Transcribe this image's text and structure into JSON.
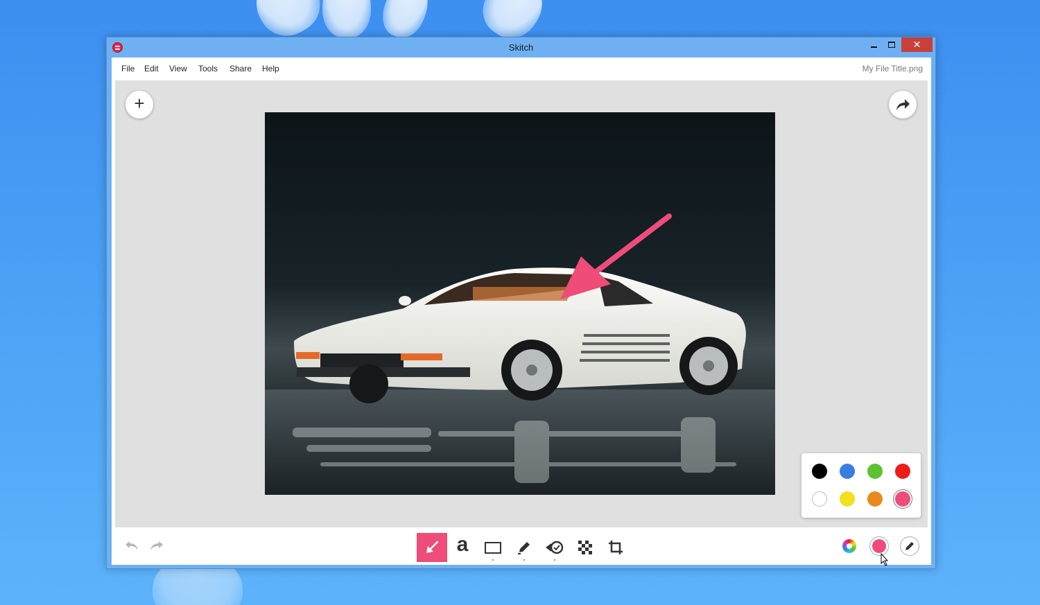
{
  "window": {
    "title": "Skitch",
    "close_glyph": "✕"
  },
  "menu": {
    "items": [
      "File",
      "Edit",
      "View",
      "Tools",
      "Share",
      "Help"
    ],
    "file_title": "My File Title.png"
  },
  "canvas": {
    "add_glyph": "+",
    "share_icon": "share-arrow-icon"
  },
  "palette": {
    "colors": [
      "#000000",
      "#3a7de3",
      "#5cc22e",
      "#f01a1a",
      "#ffffff",
      "#f2e11c",
      "#e98a1e",
      "#ef4c79"
    ],
    "selected": "#ef4c79"
  },
  "toolbar": {
    "tools": [
      "arrow",
      "text",
      "rectangle",
      "pen",
      "stamp",
      "pixelate",
      "crop"
    ],
    "active_tool": "arrow",
    "text_tool_glyph": "a",
    "accent": "#ef4c79",
    "current_color": "#ef4c79"
  }
}
